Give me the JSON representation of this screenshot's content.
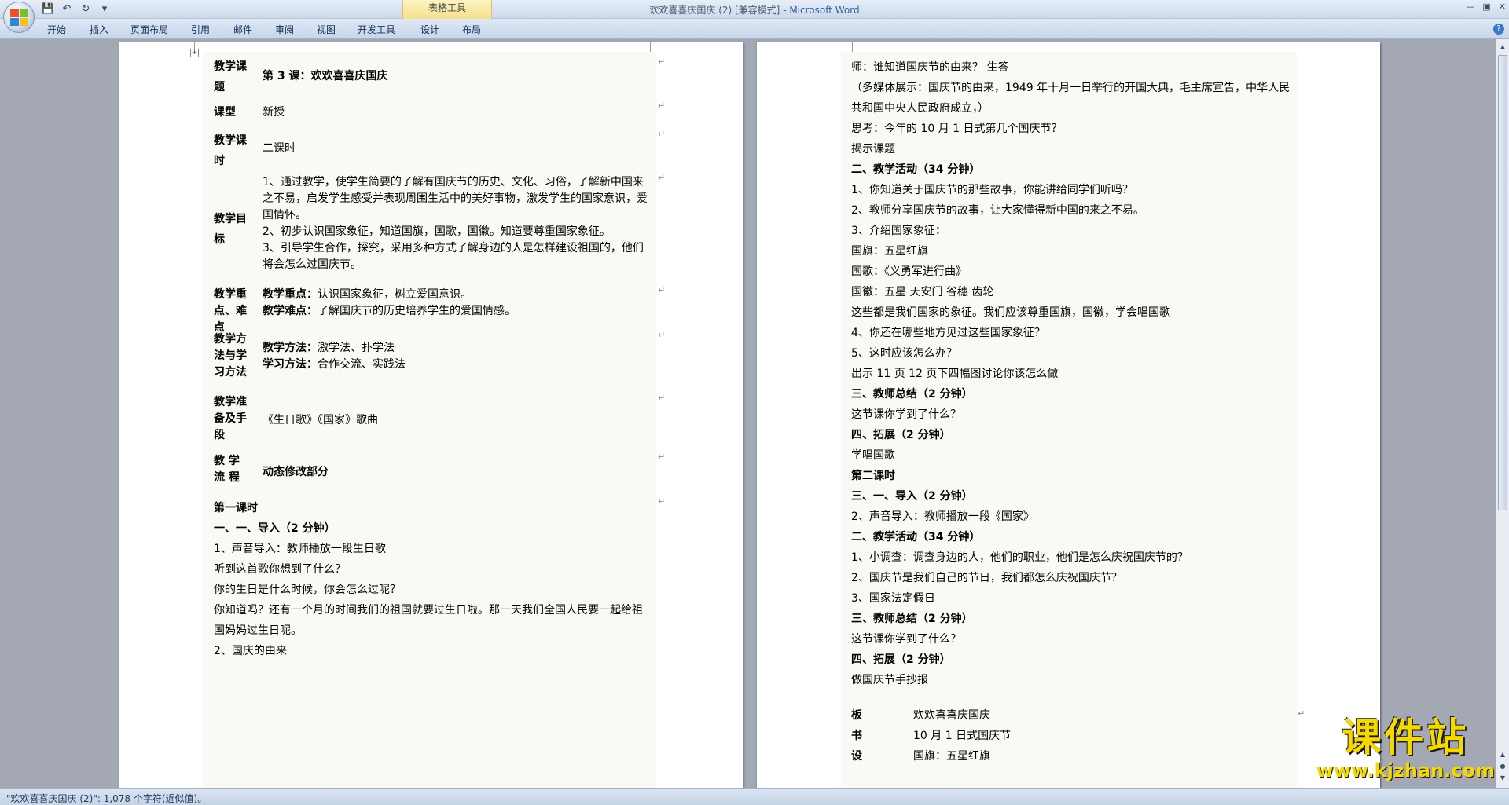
{
  "window": {
    "title": "欢欢喜喜庆国庆 (2) [兼容模式] - ",
    "app_name": "Microsoft Word",
    "contextual_tab": "表格工具"
  },
  "ribbon": {
    "tabs": [
      "开始",
      "插入",
      "页面布局",
      "引用",
      "邮件",
      "审阅",
      "视图",
      "开发工具",
      "设计",
      "布局"
    ]
  },
  "page1": {
    "table": [
      {
        "label": "教学课题",
        "value": "第 3 课：欢欢喜喜庆国庆"
      },
      {
        "label": "课型",
        "value": "新授"
      },
      {
        "label": "教学课时",
        "value": "二课时"
      },
      {
        "label": "教学目标",
        "value": "1、通过教学，使学生简要的了解有国庆节的历史、文化、习俗，了解新中国来之不易，启发学生感受并表现周围生活中的美好事物，激发学生的国家意识，爱国情怀。\n2、初步认识国家象征，知道国旗，国歌，国徽。知道要尊重国家象征。\n3、引导学生合作，探究，采用多种方式了解身边的人是怎样建设祖国的，他们将会怎么过国庆节。"
      },
      {
        "label": "教学重点、难点",
        "value_a_key": "教学重点：",
        "value_a": "认识国家象征，树立爱国意识。",
        "value_b_key": "教学难点：",
        "value_b": "了解国庆节的历史培养学生的爱国情感。"
      },
      {
        "label": "教学方法与学习方法",
        "value_a_key": "教学方法：",
        "value_a": "激学法、扑学法",
        "value_b_key": "学习方法：",
        "value_b": "合作交流、实践法"
      },
      {
        "label": "教学准备及手段",
        "value": "《生日歌》《国家》歌曲"
      },
      {
        "label": "教 学 流 程",
        "value": "动态修改部分"
      }
    ],
    "lines": [
      "第一课时",
      "一、一、导入（2 分钟）",
      "1、声音导入：教师播放一段生日歌",
      "听到这首歌你想到了什么？",
      "你的生日是什么时候，你会怎么过呢？",
      "你知道吗？还有一个月的时间我们的祖国就要过生日啦。那一天我们全国人民要一起给祖国妈妈过生日呢。",
      "2、国庆的由来"
    ]
  },
  "page2": {
    "lines": [
      "师：谁知道国庆节的由来？ 生答",
      "（多媒体展示：国庆节的由来，1949 年十月一日举行的开国大典，毛主席宣告，中华人民共和国中央人民政府成立，）",
      "思考：今年的 10 月 1 日式第几个国庆节？",
      "揭示课题",
      "二、教学活动（34 分钟）",
      "1、你知道关于国庆节的那些故事，你能讲给同学们听吗？",
      "2、教师分享国庆节的故事，让大家懂得新中国的来之不易。",
      "3、介绍国家象征：",
      "国旗：五星红旗",
      "国歌：《义勇军进行曲》",
      "国徽：五星 天安门 谷穗 齿轮",
      "这些都是我们国家的象征。我们应该尊重国旗，国徽，学会唱国歌",
      "4、你还在哪些地方见过这些国家象征？",
      "5、这时应该怎么办？",
      "出示 11 页 12 页下四幅图讨论你该怎么做",
      "三、教师总结（2 分钟）",
      "这节课你学到了什么？",
      "四、拓展（2 分钟）",
      "学唱国歌",
      "第二课时",
      "三、一、导入（2 分钟）",
      "2、声音导入：教师播放一段《国家》",
      "二、教学活动（34 分钟）",
      "1、小调查：调查身边的人，他们的职业，他们是怎么庆祝国庆节的？",
      "2、国庆节是我们自己的节日，我们都怎么庆祝国庆节？",
      "3、国家法定假日",
      "三、教师总结（2 分钟）",
      "这节课你学到了什么？",
      "四、拓展（2 分钟）",
      "做国庆节手抄报"
    ],
    "board": [
      {
        "label": "板",
        "value": "欢欢喜喜庆国庆"
      },
      {
        "label": "书",
        "value": "10 月 1 日式国庆节"
      },
      {
        "label": "设",
        "value": "国旗：五星红旗"
      }
    ]
  },
  "status": {
    "text": "\"欢欢喜喜庆国庆 (2)\": 1,078 个字符(近似值)。"
  },
  "watermark": {
    "cn": "课件站",
    "url": "www.kjzhan.com"
  },
  "colors": {
    "ribbon_bg": "#c7d6ea",
    "page_shade": "#f9f9f6",
    "contextual_tab": "#f4e08c",
    "watermark": "#f5d800"
  }
}
